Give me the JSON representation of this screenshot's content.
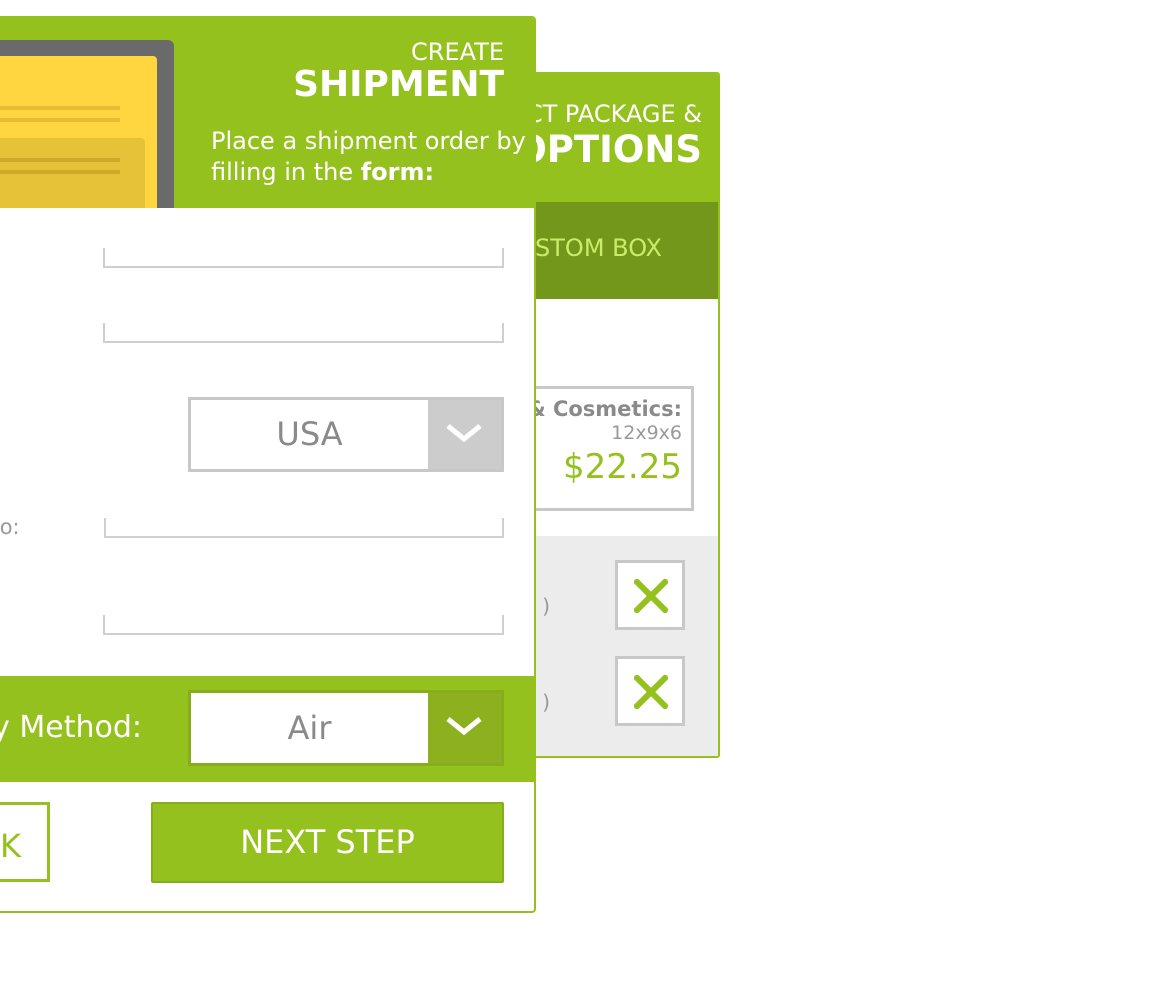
{
  "package_panel": {
    "title_small": "CT PACKAGE &",
    "title_big": "OPTIONS",
    "tab_label": "USTOM BOX",
    "package": {
      "name": "& Cosmetics:",
      "dims": "12x9x6",
      "price": "$22.25"
    },
    "options": [
      {
        "label": ")",
        "remove_icon": "close-icon"
      },
      {
        "label": ")",
        "remove_icon": "close-icon"
      }
    ]
  },
  "shipment_form": {
    "title_small": "CREATE",
    "title_big": "SHIPMENT",
    "description_line1": "Place a shipment order by",
    "description_line2_prefix": "filling in the ",
    "description_line2_bold": "form:",
    "fields": {
      "field1_label": ":",
      "country_label": ":",
      "country_value": "USA",
      "phone_label": "No:"
    },
    "delivery": {
      "label": "y Method:",
      "value": "Air"
    },
    "back_label": "K",
    "next_label": "NEXT STEP"
  },
  "colors": {
    "accent": "#95c11f",
    "accent_dark": "#72971a",
    "tab_text": "#c9ec6a",
    "illustration_yellow": "#ffd63f"
  }
}
